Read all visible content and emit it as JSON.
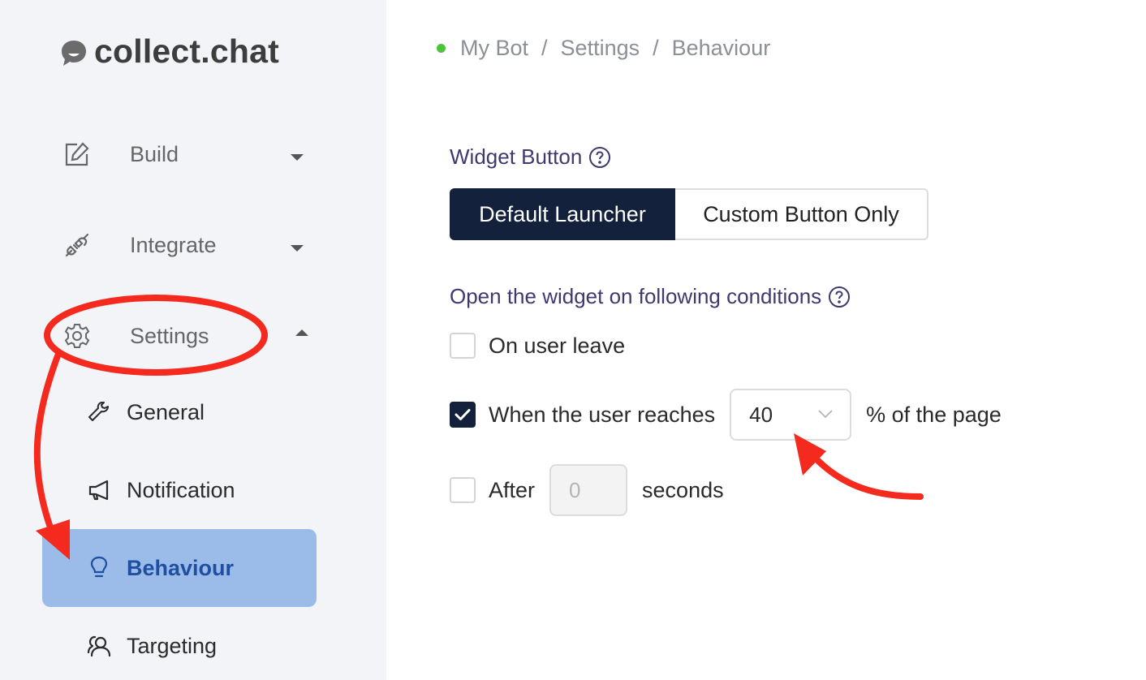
{
  "logo": {
    "text": "collect.chat"
  },
  "sidebar": {
    "items": [
      {
        "label": "Build",
        "icon": "edit-icon",
        "expanded": false
      },
      {
        "label": "Integrate",
        "icon": "plug-icon",
        "expanded": false
      },
      {
        "label": "Settings",
        "icon": "gear-icon",
        "expanded": true
      }
    ],
    "sub_items": [
      {
        "label": "General",
        "icon": "wrench-icon",
        "active": false
      },
      {
        "label": "Notification",
        "icon": "megaphone-icon",
        "active": false
      },
      {
        "label": "Behaviour",
        "icon": "lightbulb-icon",
        "active": true
      },
      {
        "label": "Targeting",
        "icon": "users-icon",
        "active": false
      }
    ]
  },
  "breadcrumb": {
    "status_color": "#4cc33b",
    "items": [
      "My Bot",
      "Settings",
      "Behaviour"
    ],
    "separator": "/"
  },
  "widget_button": {
    "title": "Widget Button",
    "options": [
      "Default Launcher",
      "Custom Button Only"
    ],
    "selected": "Default Launcher"
  },
  "conditions": {
    "title": "Open the widget on following conditions",
    "on_user_leave": {
      "label": "On user leave",
      "checked": false
    },
    "scroll": {
      "label_before": "When the user reaches",
      "value": "40",
      "label_after": "% of the page",
      "checked": true
    },
    "after": {
      "label_before": "After",
      "value": "0",
      "label_after": "seconds",
      "checked": false
    }
  },
  "colors": {
    "accent_dark": "#14213d",
    "active_nav_bg": "#9bbbe8",
    "active_nav_text": "#1f4fa3",
    "annotation_red": "#f52a1f"
  }
}
